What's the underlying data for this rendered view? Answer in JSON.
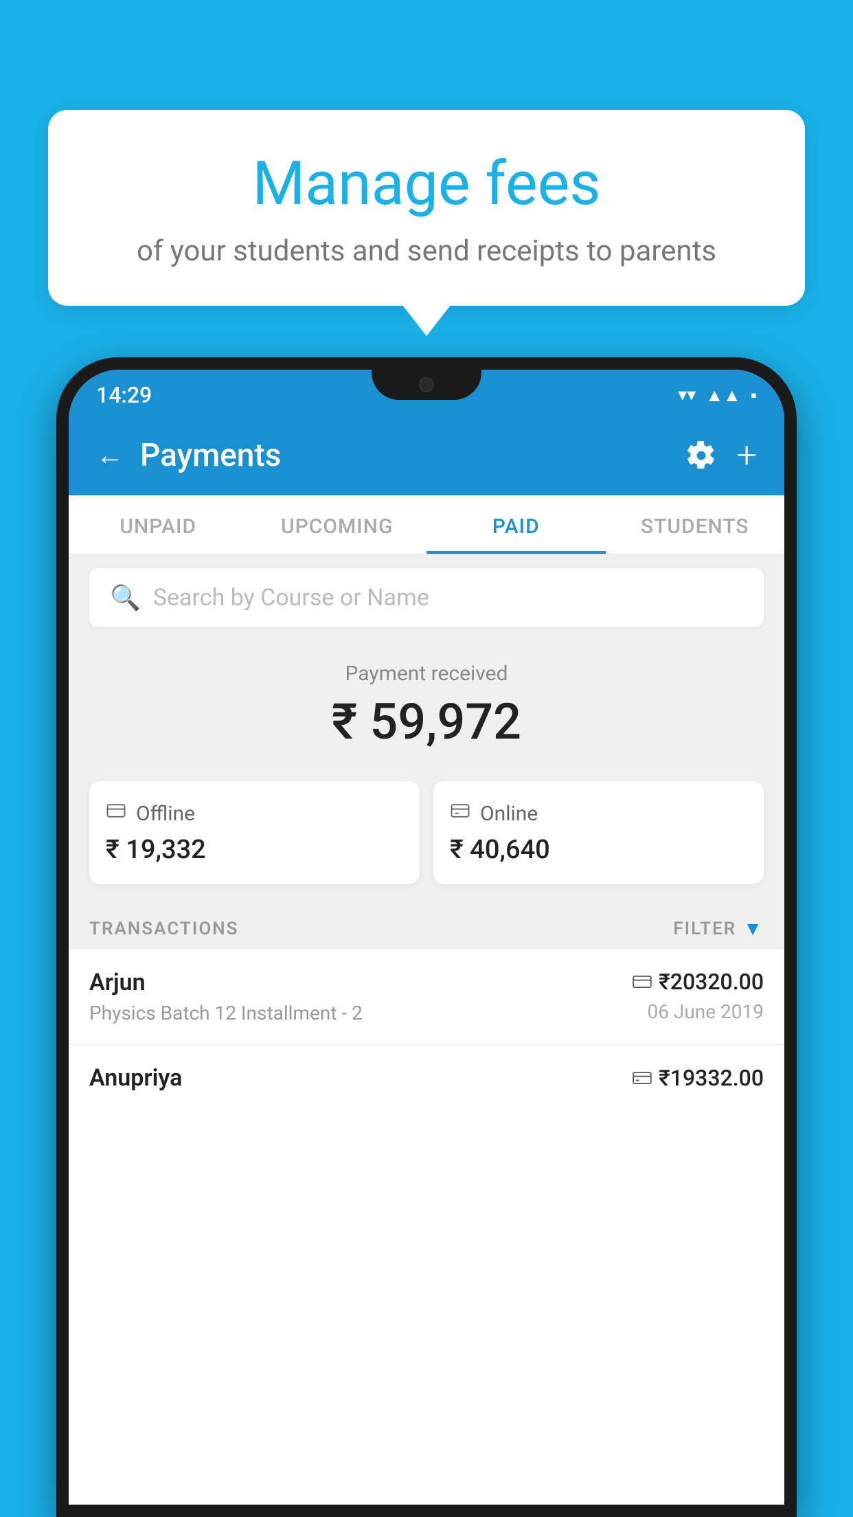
{
  "background_color": "#1ab0e8",
  "bubble": {
    "title": "Manage fees",
    "subtitle": "of your students and send receipts to parents"
  },
  "status_bar": {
    "time": "14:29"
  },
  "header": {
    "title": "Payments",
    "back_label": "←",
    "plus_label": "+"
  },
  "tabs": [
    {
      "label": "UNPAID",
      "active": false
    },
    {
      "label": "UPCOMING",
      "active": false
    },
    {
      "label": "PAID",
      "active": true
    },
    {
      "label": "STUDENTS",
      "active": false
    }
  ],
  "search": {
    "placeholder": "Search by Course or Name"
  },
  "payment_received": {
    "label": "Payment received",
    "total": "₹ 59,972",
    "offline_label": "Offline",
    "offline_amount": "₹ 19,332",
    "online_label": "Online",
    "online_amount": "₹ 40,640"
  },
  "transactions_section": {
    "label": "TRANSACTIONS",
    "filter_label": "FILTER"
  },
  "transactions": [
    {
      "name": "Arjun",
      "description": "Physics Batch 12 Installment - 2",
      "amount": "₹20320.00",
      "date": "06 June 2019",
      "method": "online"
    },
    {
      "name": "Anupriya",
      "description": "",
      "amount": "₹19332.00",
      "date": "",
      "method": "offline"
    }
  ]
}
